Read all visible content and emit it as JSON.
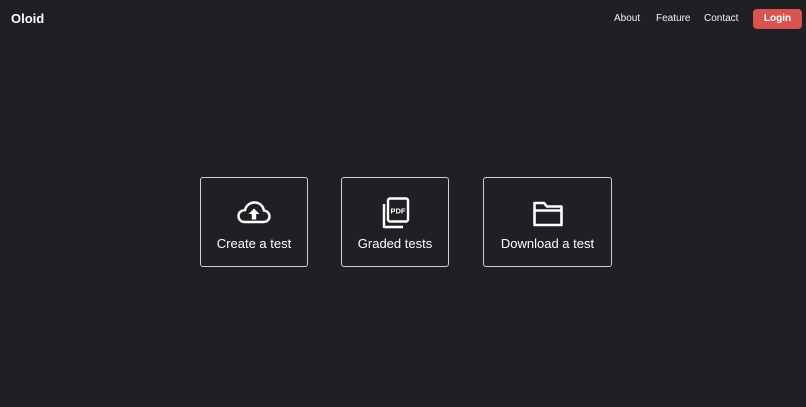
{
  "navbar": {
    "brand": "Oloid",
    "links": [
      {
        "label": "About"
      },
      {
        "label": "Feature"
      },
      {
        "label": "Contact"
      }
    ],
    "login_label": "Login",
    "login_color": "#d9534f"
  },
  "cards": [
    {
      "label": "Create a test",
      "icon": "cloud-upload-icon"
    },
    {
      "label": "Graded tests",
      "icon": "pdf-files-icon",
      "icon_text": "PDF"
    },
    {
      "label": "Download a test",
      "icon": "folder-icon"
    }
  ],
  "colors": {
    "background": "#202024",
    "card_border": "#cfcfd3"
  }
}
